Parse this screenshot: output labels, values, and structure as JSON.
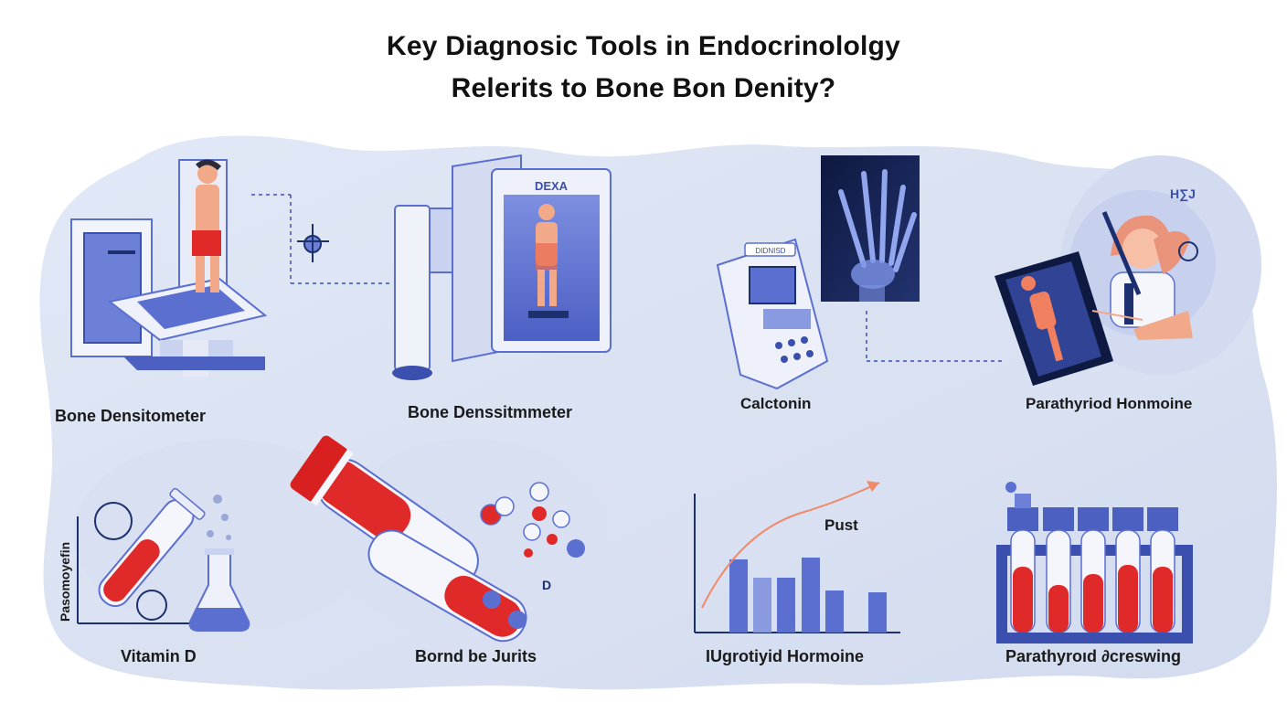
{
  "header": {
    "title_line1": "Key Diagnosic Tools  in Endocrinololgy",
    "title_line2": "Relerits to Bone Bon Denity?"
  },
  "colors": {
    "background_blob": "#dbe3f3",
    "accent_blue": "#5b6fd0",
    "dark_blue": "#1c2f6e",
    "blood_red": "#e02a2a",
    "skin": "#f2a98a",
    "curve_orange": "#f08a6a"
  },
  "panels": [
    {
      "id": "bone-densitometer",
      "label": "Bone Densitometer",
      "icon": "scanner-table-icon"
    },
    {
      "id": "dexa",
      "label": "Bone Denssitmmeter",
      "icon": "dexa-machine-icon",
      "screen_text": "DEXA"
    },
    {
      "id": "calcitonin",
      "label": "Calctonin",
      "icon": "hand-xray-icon",
      "device_text": "DIDNISD"
    },
    {
      "id": "parathyroid",
      "label": "Parathyriod Honmoine",
      "icon": "doctor-icon",
      "note_text": "H∑J"
    },
    {
      "id": "vitamin-d",
      "label": "Vitamin D",
      "icon": "test-tube-icon",
      "axis_text": "Pasomoyefin"
    },
    {
      "id": "blood",
      "label": "Bornd be Jurits",
      "icon": "blood-tube-icon",
      "marker_text": "D"
    },
    {
      "id": "thyroid-chart",
      "label": "IUgrotiyid Hormoine",
      "icon": "bar-chart-icon",
      "curve_label": "Pust"
    },
    {
      "id": "tube-rack",
      "label": "Parathyroıd ∂creswing",
      "icon": "tube-rack-icon"
    }
  ]
}
